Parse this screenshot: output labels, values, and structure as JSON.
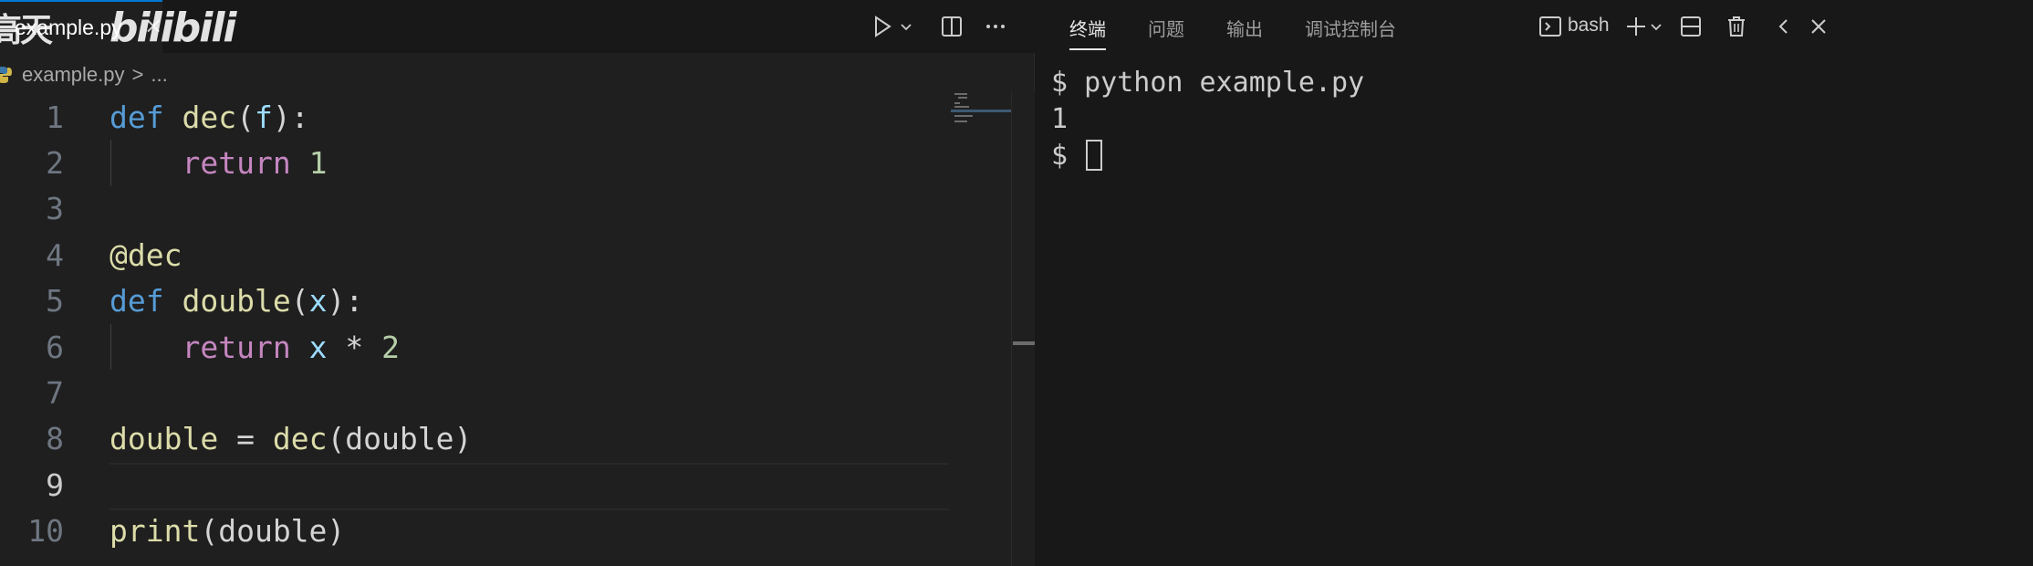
{
  "editor": {
    "tab": {
      "filename": "example.py",
      "close": "×"
    },
    "watermark": {
      "cn": "高天",
      "logo": "bilibili"
    },
    "actions": {
      "run": "run-icon",
      "split": "split-editor-icon",
      "more": "more-icon"
    },
    "breadcrumb": {
      "file": "example.py",
      "separator": ">",
      "ellipsis": "..."
    },
    "lines": [
      {
        "n": "1",
        "tokens": [
          [
            "kw",
            "def"
          ],
          [
            "op",
            " "
          ],
          [
            "fn",
            "dec"
          ],
          [
            "op",
            "("
          ],
          [
            "param",
            "f"
          ],
          [
            "op",
            "):"
          ]
        ]
      },
      {
        "n": "2",
        "guide": true,
        "tokens": [
          [
            "op",
            "    "
          ],
          [
            "ctl",
            "return"
          ],
          [
            "op",
            " "
          ],
          [
            "num",
            "1"
          ]
        ]
      },
      {
        "n": "3",
        "tokens": []
      },
      {
        "n": "4",
        "tokens": [
          [
            "deco",
            "@dec"
          ]
        ]
      },
      {
        "n": "5",
        "tokens": [
          [
            "kw",
            "def"
          ],
          [
            "op",
            " "
          ],
          [
            "fn",
            "double"
          ],
          [
            "op",
            "("
          ],
          [
            "param",
            "x"
          ],
          [
            "op",
            "):"
          ]
        ]
      },
      {
        "n": "6",
        "guide": true,
        "tokens": [
          [
            "op",
            "    "
          ],
          [
            "ctl",
            "return"
          ],
          [
            "op",
            " "
          ],
          [
            "param",
            "x"
          ],
          [
            "op",
            " * "
          ],
          [
            "num",
            "2"
          ]
        ]
      },
      {
        "n": "7",
        "tokens": []
      },
      {
        "n": "8",
        "tokens": [
          [
            "fn",
            "double"
          ],
          [
            "op",
            " = "
          ],
          [
            "fn",
            "dec"
          ],
          [
            "op",
            "(double)"
          ]
        ]
      },
      {
        "n": "9",
        "current": true,
        "tokens": []
      },
      {
        "n": "10",
        "tokens": [
          [
            "fn",
            "print"
          ],
          [
            "op",
            "(double)"
          ]
        ]
      }
    ]
  },
  "panel": {
    "tabs": [
      "终端",
      "问题",
      "输出",
      "调试控制台"
    ],
    "active_tab": 0,
    "shell": "bash",
    "terminal_lines": [
      "$ python example.py",
      "1",
      "$ "
    ]
  },
  "colors": {
    "keyword": "#569cd6",
    "function": "#dcdcaa",
    "parameter": "#9cdcfe",
    "control": "#c586c0",
    "number": "#b5cea8",
    "accent": "#0078d4"
  }
}
